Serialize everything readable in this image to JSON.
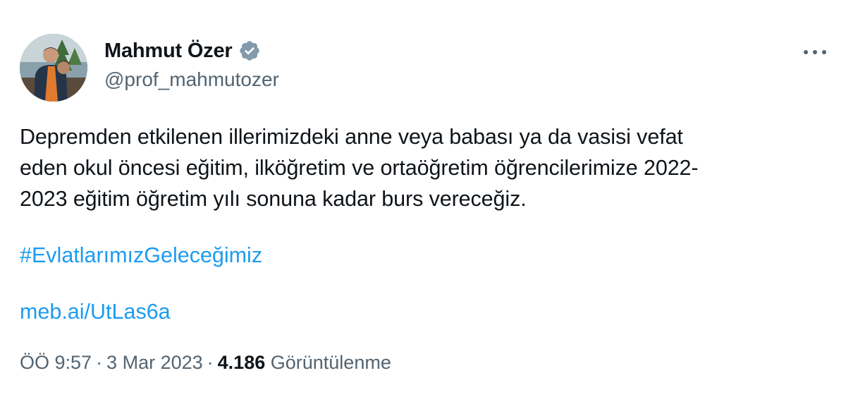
{
  "tweet": {
    "author": {
      "display_name": "Mahmut Özer",
      "handle": "@prof_mahmutozer",
      "verified_icon": "verified-badge-icon",
      "avatar_icon": "profile-photo"
    },
    "more_icon": "more-options-icon",
    "body_lines": [
      "Depremden etkilenen illerimizdeki anne veya babası ya da vasisi vefat",
      "eden okul öncesi eğitim, ilköğretim ve ortaöğretim öğrencilerimize 2022-",
      "2023 eğitim öğretim yılı sonuna kadar burs vereceğiz."
    ],
    "hashtag": "#EvlatlarımızGeleceğimiz",
    "link": "meb.ai/UtLas6a",
    "meta": {
      "time": "ÖÖ 9:57",
      "separator": "·",
      "date": "3 Mar 2023",
      "views_count": "4.186",
      "views_label": "Görüntülenme"
    },
    "colors": {
      "text": "#0f1419",
      "secondary": "#536471",
      "link": "#1d9bf0",
      "verified_badge": "#829aab"
    }
  }
}
